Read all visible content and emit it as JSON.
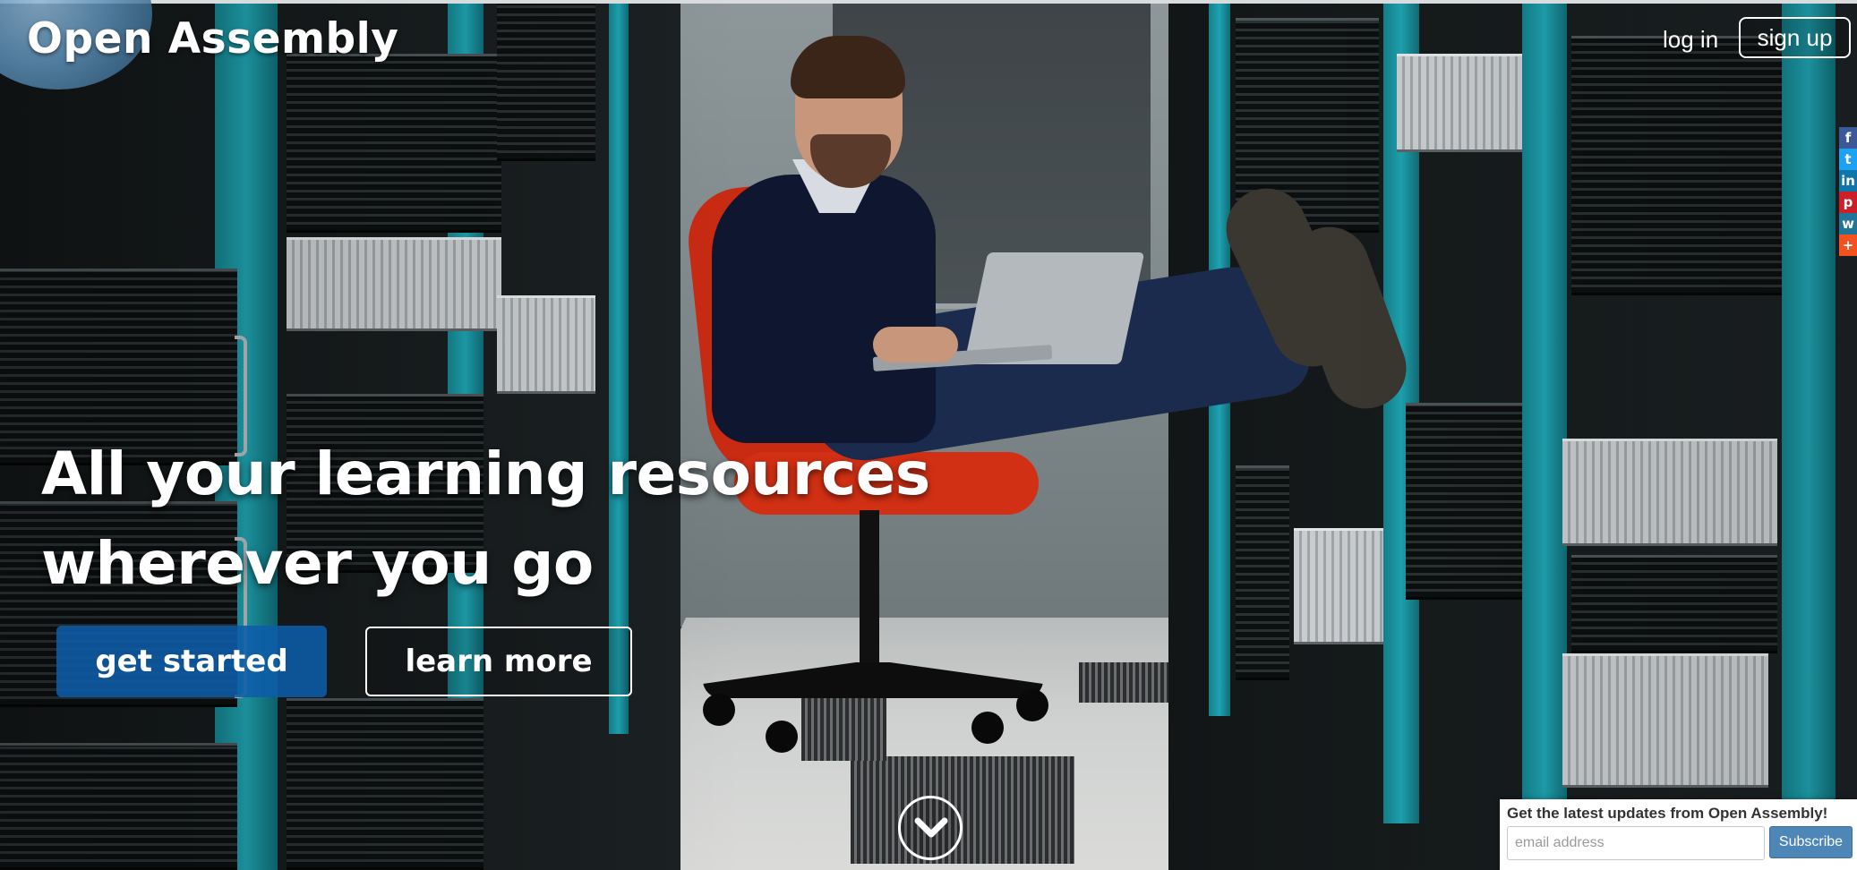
{
  "header": {
    "logo_text": "Open Assembly",
    "login_label": "log in",
    "signup_label": "sign up"
  },
  "share_bar": [
    {
      "icon": "facebook-icon",
      "glyph": "f",
      "color": "#3b5998"
    },
    {
      "icon": "twitter-icon",
      "glyph": "t",
      "color": "#1da1f2"
    },
    {
      "icon": "linkedin-icon",
      "glyph": "in",
      "color": "#0e76a8"
    },
    {
      "icon": "pinterest-icon",
      "glyph": "p",
      "color": "#cb2027"
    },
    {
      "icon": "wordpress-icon",
      "glyph": "w",
      "color": "#21759b"
    },
    {
      "icon": "more-share-icon",
      "glyph": "+",
      "color": "#f4511e"
    }
  ],
  "hero": {
    "headline_line1": "All your learning resources",
    "headline_line2": "wherever you go",
    "primary_cta": "get started",
    "secondary_cta": "learn more",
    "scroll_icon": "chevron-down-icon"
  },
  "subscribe": {
    "title": "Get the latest updates from Open Assembly!",
    "email_placeholder": "email address",
    "email_value": "",
    "button_label": "Subscribe"
  },
  "colors": {
    "primary_button": "#0d5ca8",
    "subscribe_button": "#4f86b8",
    "rack_teal": "#1fa2b0",
    "chair_red": "#c92a12"
  }
}
